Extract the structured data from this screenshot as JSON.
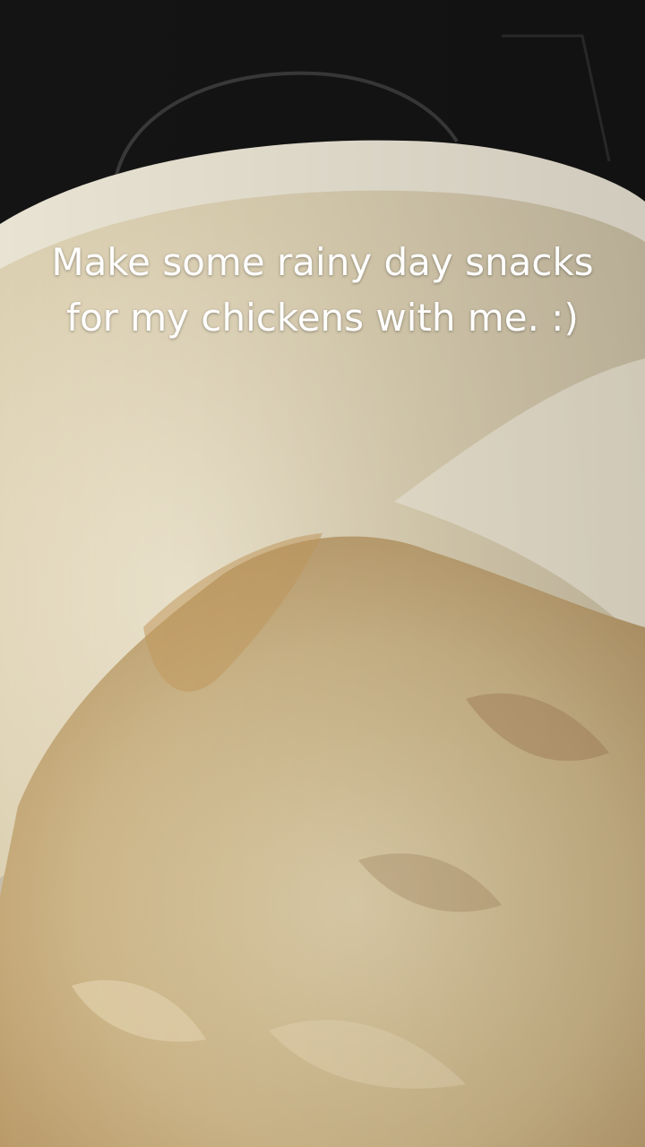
{
  "caption": {
    "text": "Make some rainy day snacks for my chickens with me. :)"
  },
  "scene": {
    "stovetop_color": "#141414",
    "bowl_color": "#e9e3d3",
    "bowl_inner_color": "#d8cdb2",
    "oats_color": "#d8c49c",
    "cinnamon_color": "#b3895a"
  }
}
